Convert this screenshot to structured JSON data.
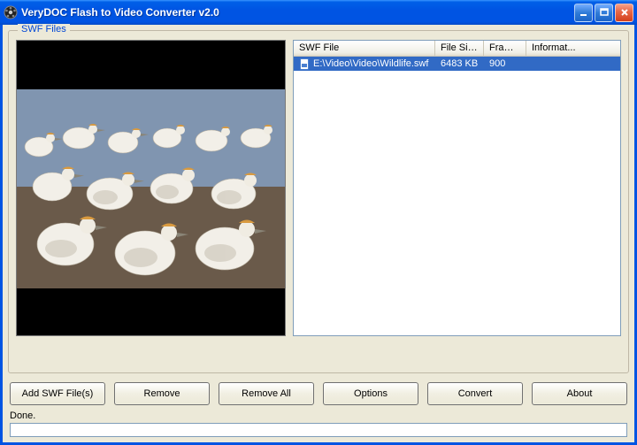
{
  "window": {
    "title": "VeryDOC Flash to Video Converter v2.0"
  },
  "groupbox": {
    "legend": "SWF Files"
  },
  "columns": {
    "file": "SWF File",
    "size": "File Size",
    "frame": "Frame ...",
    "info": "Informat..."
  },
  "rows": [
    {
      "file": "E:\\Video\\Video\\Wildlife.swf",
      "size": "6483 KB",
      "frame": "900",
      "info": ""
    }
  ],
  "buttons": {
    "add": "Add SWF File(s)",
    "remove": "Remove",
    "removeAll": "Remove All",
    "options": "Options",
    "convert": "Convert",
    "about": "About"
  },
  "status": {
    "text": "Done."
  }
}
